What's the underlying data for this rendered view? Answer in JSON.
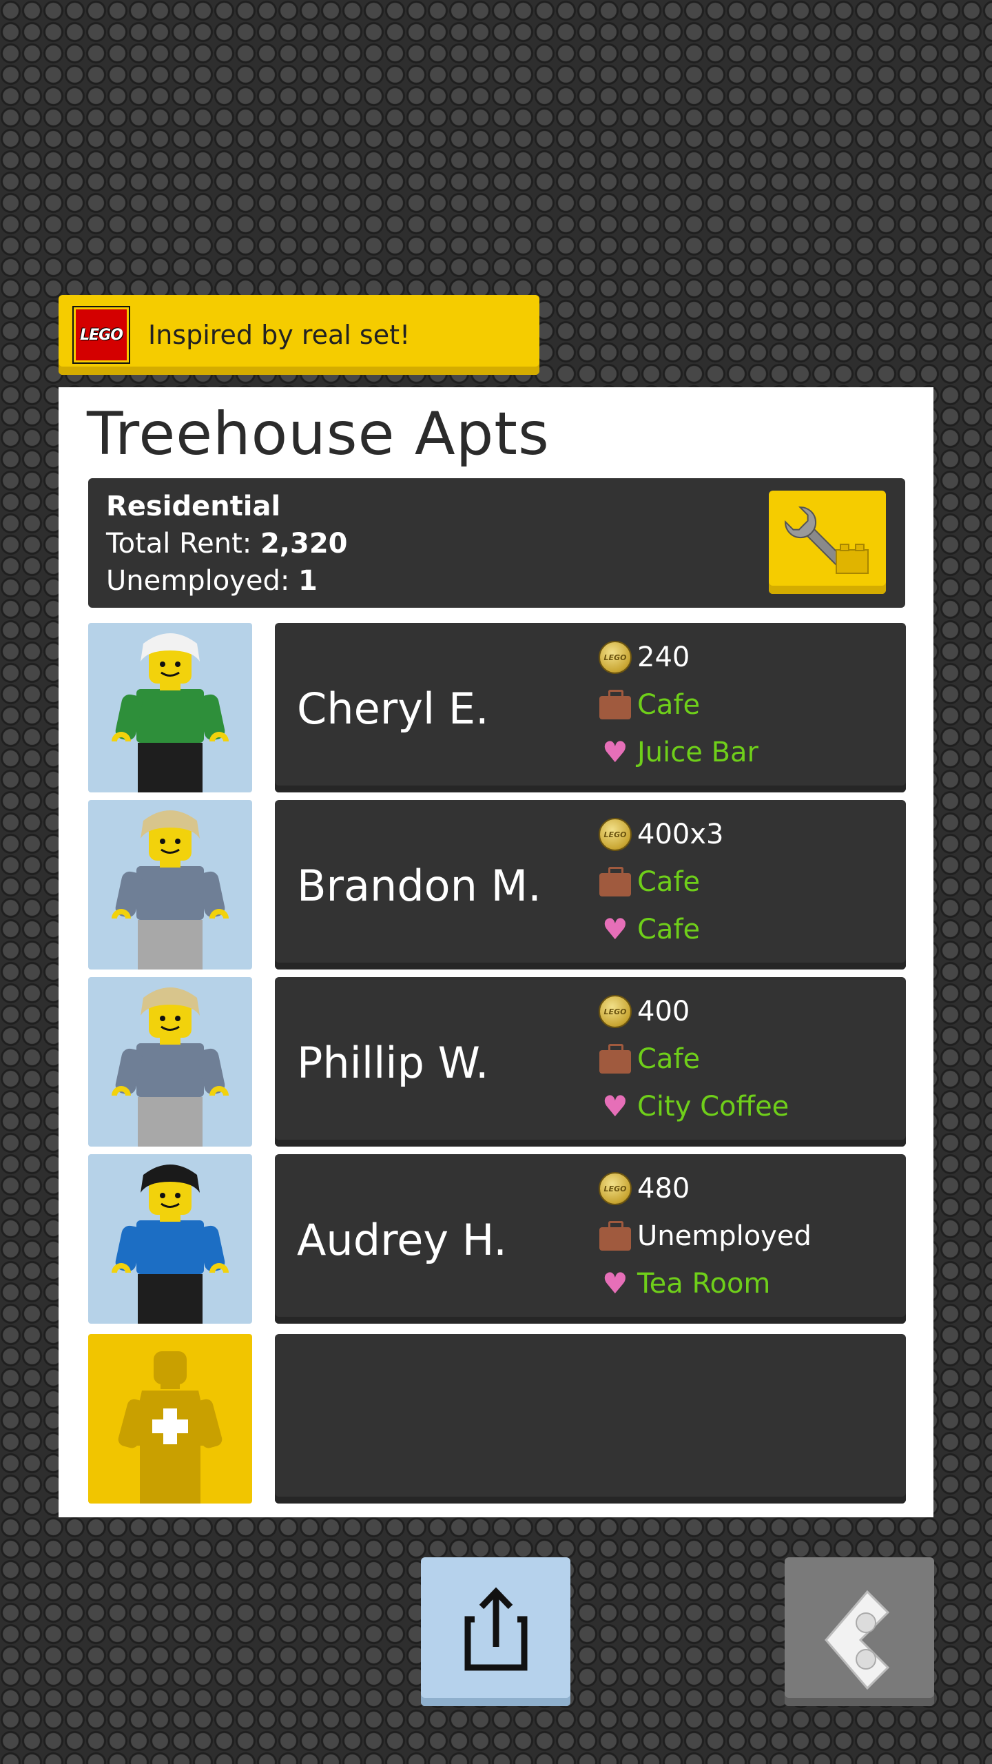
{
  "banner": {
    "logo_text": "LEGO",
    "text": "Inspired by real set!"
  },
  "building": {
    "title": "Treehouse Apts",
    "type": "Residential",
    "total_rent_label": "Total Rent: ",
    "total_rent_value": "2,320",
    "unemployed_label": "Unemployed: ",
    "unemployed_value": "1"
  },
  "residents": [
    {
      "name": "Cheryl E.",
      "rent": "240",
      "job": "Cafe",
      "favorite": "Juice Bar",
      "hair": "#f2f2f2",
      "shirt": "#2e8f3a",
      "legs": "#1e1e1e"
    },
    {
      "name": "Brandon M.",
      "rent": "400x3",
      "job": "Cafe",
      "favorite": "Cafe",
      "hair": "#d8c58c",
      "shirt": "#6f7f96",
      "legs": "#a8a8a8"
    },
    {
      "name": "Phillip W.",
      "rent": "400",
      "job": "Cafe",
      "favorite": "City Coffee",
      "hair": "#d8c58c",
      "shirt": "#6f7f96",
      "legs": "#a8a8a8"
    },
    {
      "name": "Audrey H.",
      "rent": "480",
      "job": "Unemployed",
      "favorite": "Tea Room",
      "hair": "#1a1a1a",
      "shirt": "#1c6ec4",
      "legs": "#1e1e1e"
    }
  ],
  "colors": {
    "accent": "#f5cc00",
    "green_text": "#6fcf1a",
    "heart": "#e66fb8",
    "briefcase": "#a05a3e"
  },
  "icons": {
    "rent": "lego-coin-icon",
    "job": "briefcase-icon",
    "favorite": "heart-icon",
    "share": "share-icon",
    "back": "back-brick-icon",
    "settings": "wrench-brick-icon",
    "add": "add-minifig-icon"
  }
}
